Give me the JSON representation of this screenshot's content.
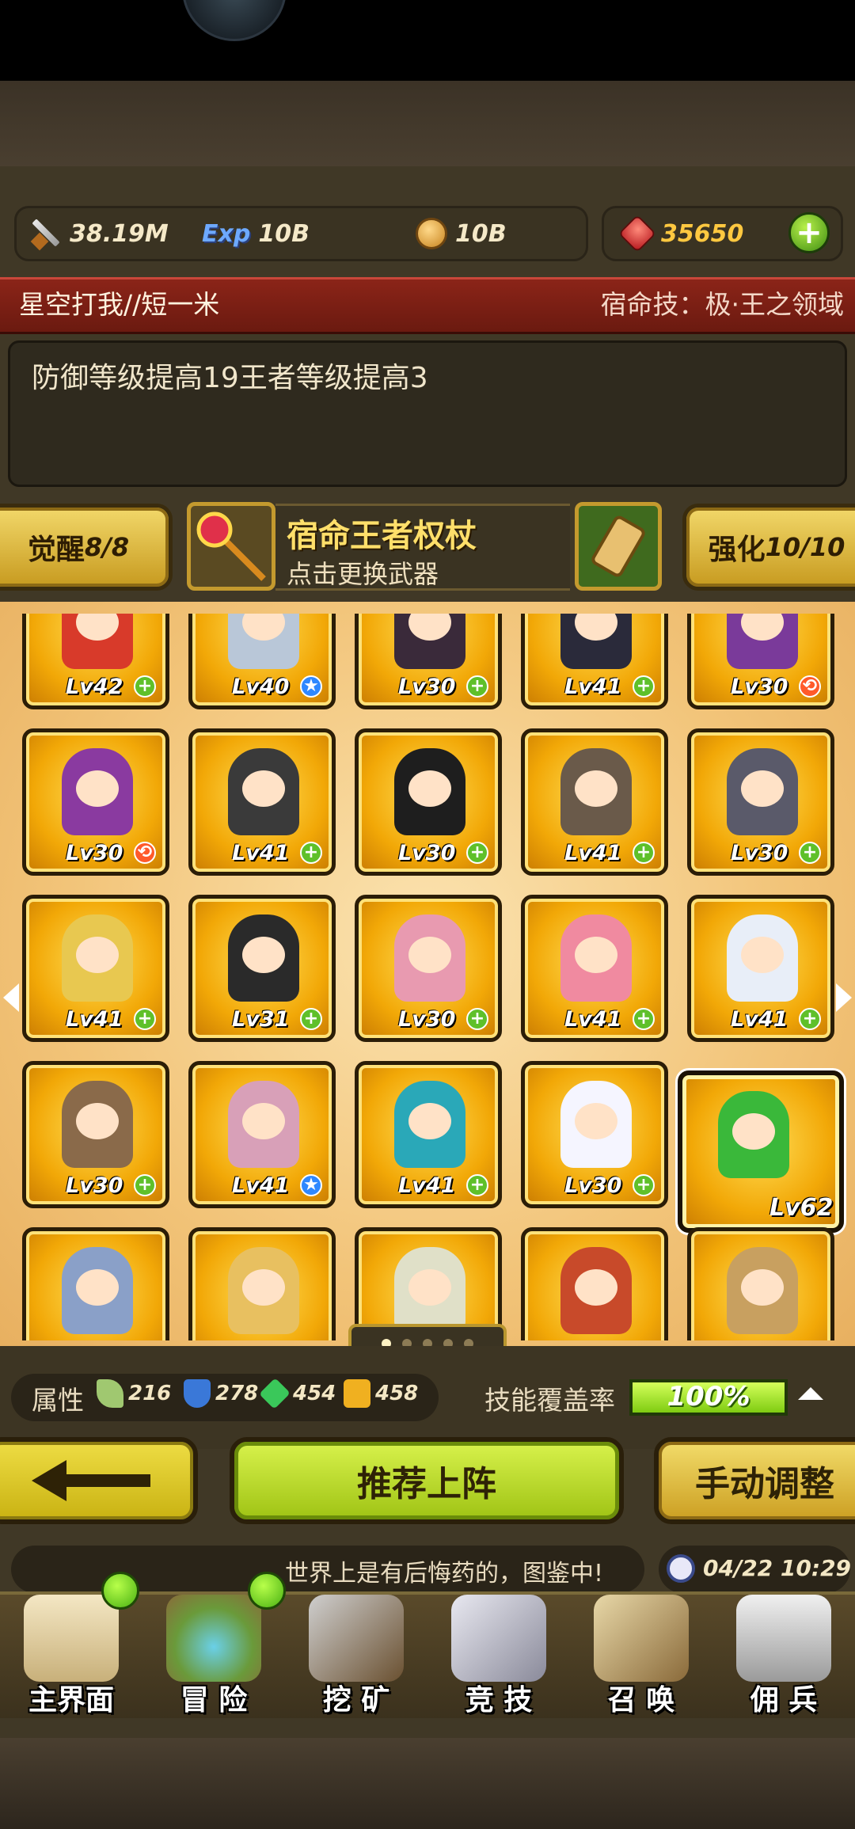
{
  "resources": {
    "power": "38.19M",
    "exp_label": "Exp",
    "exp": "10B",
    "gold": "10B",
    "gems": "35650"
  },
  "hero": {
    "name": "星空打我//短一米",
    "fate_skill": "宿命技：极·王之领域",
    "description": "防御等级提高19王者等级提高3"
  },
  "awaken": {
    "label": "觉醒",
    "value": "8/8"
  },
  "enhance": {
    "label": "强化",
    "value": "10/10"
  },
  "weapon": {
    "name": "宿命王者权杖",
    "hint": "点击更换武器"
  },
  "grid": {
    "rows": [
      [
        {
          "lv": "Lv42",
          "badge": "+"
        },
        {
          "lv": "Lv40",
          "badge": "★"
        },
        {
          "lv": "Lv30",
          "badge": "+"
        },
        {
          "lv": "Lv41",
          "badge": "+"
        },
        {
          "lv": "Lv30",
          "badge": "⟲"
        }
      ],
      [
        {
          "lv": "Lv30",
          "badge": "⟲"
        },
        {
          "lv": "Lv41",
          "badge": "+"
        },
        {
          "lv": "Lv30",
          "badge": "+"
        },
        {
          "lv": "Lv41",
          "badge": "+"
        },
        {
          "lv": "Lv30",
          "badge": "+"
        }
      ],
      [
        {
          "lv": "Lv41",
          "badge": "+"
        },
        {
          "lv": "Lv31",
          "badge": "+"
        },
        {
          "lv": "Lv30",
          "badge": "+"
        },
        {
          "lv": "Lv41",
          "badge": "+"
        },
        {
          "lv": "Lv41",
          "badge": "+"
        }
      ],
      [
        {
          "lv": "Lv30",
          "badge": "+"
        },
        {
          "lv": "Lv41",
          "badge": "★"
        },
        {
          "lv": "Lv41",
          "badge": "+"
        },
        {
          "lv": "Lv30",
          "badge": "+"
        },
        {
          "lv": "Lv62",
          "badge": ""
        }
      ]
    ],
    "hero_colors": [
      [
        "#d83a2a",
        "#b9c7d8",
        "#3a2a3a",
        "#2a2a3a",
        "#7a3a9a"
      ],
      [
        "#8a3aa0",
        "#3a3a3a",
        "#1e1e1e",
        "#6a5a4a",
        "#5a5a6a"
      ],
      [
        "#e8c850",
        "#2a2a2a",
        "#e89ab0",
        "#f08aa0",
        "#e8eef8"
      ],
      [
        "#8a6a4a",
        "#d8a0b8",
        "#2aa8b8",
        "#f5f5ff",
        "#3ab83a"
      ],
      [
        "#8aa0c8",
        "#e8c060",
        "#e0e0c8",
        "#c84a2a",
        "#c8a060"
      ]
    ],
    "pages": 5,
    "current_page": 1
  },
  "attributes": {
    "label": "属性",
    "values": [
      "216",
      "278",
      "454",
      "458"
    ]
  },
  "skill_coverage": {
    "label": "技能覆盖率",
    "value": "100%",
    "fraction": 1.0
  },
  "buttons": {
    "recommend": "推荐上阵",
    "manual": "手动调整"
  },
  "ticker": "世界上是有后悔药的，图鉴中!",
  "clock": "04/22 10:29",
  "nav": [
    "主界面",
    "冒 险",
    "挖 矿",
    "竞 技",
    "召 唤",
    "佣 兵"
  ]
}
